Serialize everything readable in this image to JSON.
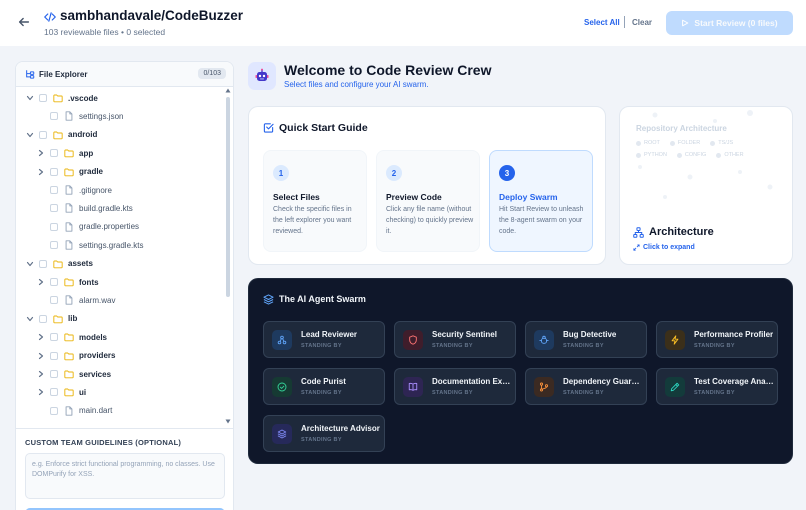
{
  "header": {
    "repo_title": "sambhandavale/CodeBuzzer",
    "subtitle": "103 reviewable files • 0 selected",
    "select_all": "Select All",
    "clear": "Clear",
    "start_review": "Start Review (0 files)"
  },
  "explorer": {
    "title": "File Explorer",
    "count": "0/103",
    "items": [
      {
        "name": ".vscode",
        "type": "folder",
        "depth": 0,
        "expanded": true
      },
      {
        "name": "settings.json",
        "type": "file",
        "depth": 1
      },
      {
        "name": "android",
        "type": "folder",
        "depth": 0,
        "expanded": true
      },
      {
        "name": "app",
        "type": "folder",
        "depth": 1,
        "expanded": false
      },
      {
        "name": "gradle",
        "type": "folder",
        "depth": 1,
        "expanded": false
      },
      {
        "name": ".gitignore",
        "type": "file",
        "depth": 1
      },
      {
        "name": "build.gradle.kts",
        "type": "file",
        "depth": 1
      },
      {
        "name": "gradle.properties",
        "type": "file",
        "depth": 1
      },
      {
        "name": "settings.gradle.kts",
        "type": "file",
        "depth": 1
      },
      {
        "name": "assets",
        "type": "folder",
        "depth": 0,
        "expanded": true
      },
      {
        "name": "fonts",
        "type": "folder",
        "depth": 1,
        "expanded": false
      },
      {
        "name": "alarm.wav",
        "type": "file",
        "depth": 1
      },
      {
        "name": "lib",
        "type": "folder",
        "depth": 0,
        "expanded": true
      },
      {
        "name": "models",
        "type": "folder",
        "depth": 1,
        "expanded": false
      },
      {
        "name": "providers",
        "type": "folder",
        "depth": 1,
        "expanded": false
      },
      {
        "name": "services",
        "type": "folder",
        "depth": 1,
        "expanded": false
      },
      {
        "name": "ui",
        "type": "folder",
        "depth": 1,
        "expanded": false
      },
      {
        "name": "main.dart",
        "type": "file",
        "depth": 1
      }
    ],
    "guidelines_label": "CUSTOM TEAM GUIDELINES (OPTIONAL)",
    "guidelines_placeholder": "e.g. Enforce strict functional programming, no classes. Use DOMPurify for XSS."
  },
  "welcome": {
    "title": "Welcome to Code Review Crew",
    "subtitle": "Select files and configure your AI swarm."
  },
  "quick_start": {
    "title": "Quick Start Guide",
    "steps": [
      {
        "num": "1",
        "title": "Select Files",
        "desc": "Check the specific files in the left explorer you want reviewed."
      },
      {
        "num": "2",
        "title": "Preview Code",
        "desc": "Click any file name (without checking) to quickly preview it."
      },
      {
        "num": "3",
        "title": "Deploy Swarm",
        "desc": "Hit Start Review to unleash the 8-agent swarm on your code."
      }
    ]
  },
  "architecture": {
    "ghost_title": "Repository Architecture",
    "legend": [
      "ROOT",
      "FOLDER",
      "TS/JS",
      "PYTHON",
      "CONFIG",
      "OTHER"
    ],
    "title": "Architecture",
    "expand": "Click to expand"
  },
  "swarm": {
    "title": "The AI Agent Swarm",
    "agents": [
      {
        "name": "Lead Reviewer",
        "status": "STANDING BY",
        "icon": "network-icon",
        "color": "#60a5fa",
        "bg": "#1e3a5f"
      },
      {
        "name": "Security Sentinel",
        "status": "STANDING BY",
        "icon": "shield-icon",
        "color": "#f87171",
        "bg": "#3f1d2b"
      },
      {
        "name": "Bug Detective",
        "status": "STANDING BY",
        "icon": "bug-icon",
        "color": "#60a5fa",
        "bg": "#1e3a5f"
      },
      {
        "name": "Performance Profiler",
        "status": "STANDING BY",
        "icon": "bolt-icon",
        "color": "#fbbf24",
        "bg": "#3b2f1a"
      },
      {
        "name": "Code Purist",
        "status": "STANDING BY",
        "icon": "check-circle-icon",
        "color": "#34d399",
        "bg": "#163a33"
      },
      {
        "name": "Documentation Expert",
        "status": "STANDING BY",
        "icon": "book-icon",
        "color": "#a78bfa",
        "bg": "#2e2553"
      },
      {
        "name": "Dependency Guardian",
        "status": "STANDING BY",
        "icon": "branch-icon",
        "color": "#fb923c",
        "bg": "#3b2a22"
      },
      {
        "name": "Test Coverage Analyst",
        "status": "STANDING BY",
        "icon": "flask-icon",
        "color": "#2dd4bf",
        "bg": "#133b3b"
      },
      {
        "name": "Architecture Advisor",
        "status": "STANDING BY",
        "icon": "layers-icon",
        "color": "#818cf8",
        "bg": "#26295a"
      }
    ]
  }
}
